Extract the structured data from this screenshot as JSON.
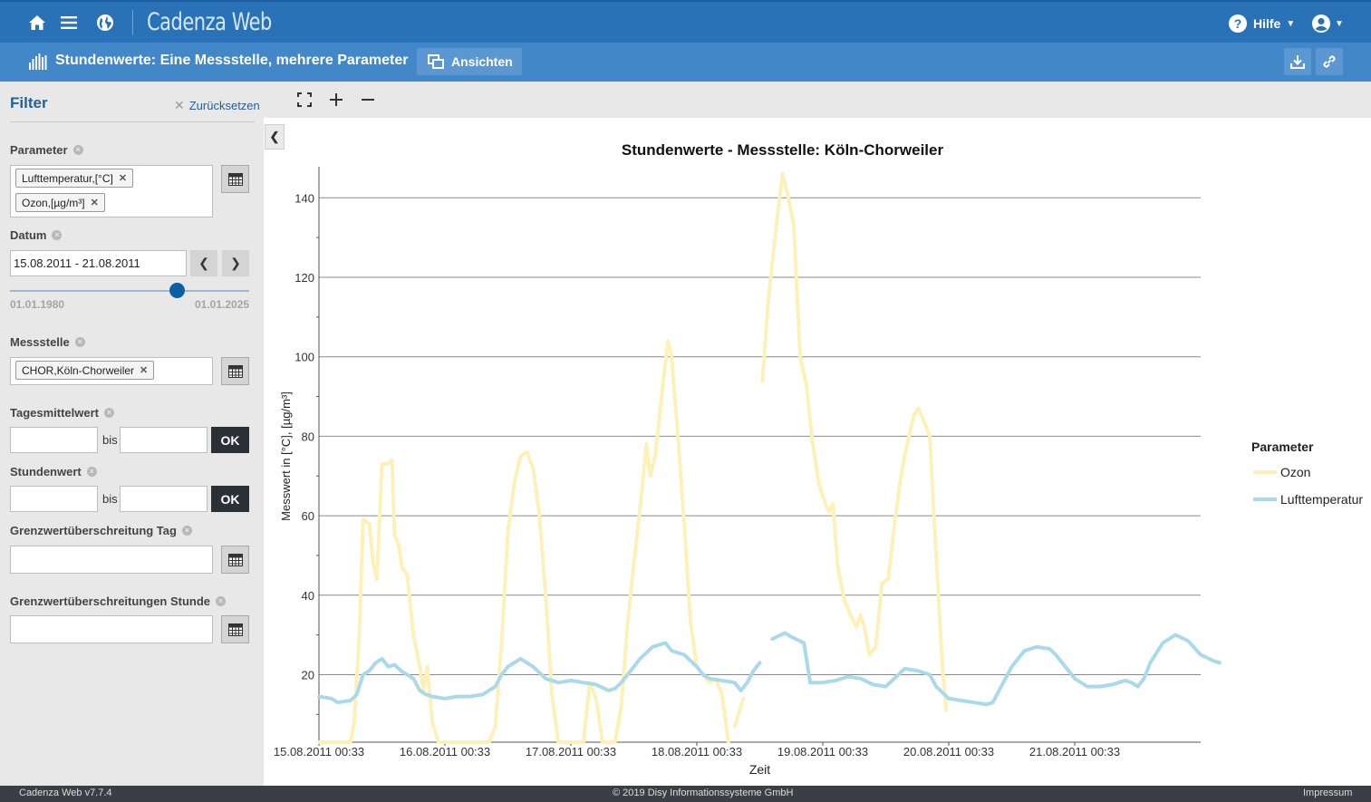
{
  "app": {
    "title": "Cadenza Web",
    "help_label": "Hilfe"
  },
  "toolbar": {
    "page_title": "Stundenwerte: Eine Messstelle, mehrere Parameter",
    "views_label": "Ansichten"
  },
  "filter": {
    "title": "Filter",
    "reset_label": "Zurücksetzen",
    "parameter_label": "Parameter",
    "parameter_tags": [
      "Lufttemperatur,[°C]",
      "Ozon,[µg/m³]"
    ],
    "datum_label": "Datum",
    "datum_value": "15.08.2011 - 21.08.2011",
    "slider_min": "01.01.1980",
    "slider_max": "01.01.2025",
    "slider_position": 0.7,
    "messstelle_label": "Messstelle",
    "messstelle_tags": [
      "CHOR,Köln-Chorweiler"
    ],
    "tagesmittel_label": "Tagesmittelwert",
    "stundenwert_label": "Stundenwert",
    "bis_label": "bis",
    "ok_label": "OK",
    "grenz_tag_label": "Grenzwertüberschreitung Tag",
    "grenz_stunde_label": "Grenzwertüberschreitungen Stunde"
  },
  "chart_data": {
    "type": "line",
    "title": "Stundenwerte - Messstelle: Köln-Chorweiler",
    "xlabel": "Zeit",
    "ylabel": "Messwert in [°C], [µg/m³]",
    "x_tick_labels": [
      "15.08.2011 00:33",
      "16.08.2011 00:33",
      "17.08.2011 00:33",
      "18.08.2011 00:33",
      "19.08.2011 00:33",
      "20.08.2011 00:33",
      "21.08.2011 00:33"
    ],
    "ylim": [
      3,
      146
    ],
    "y_ticks": [
      20,
      40,
      60,
      80,
      100,
      120,
      140
    ],
    "x_unit": "days since 15.08.2011 00:33",
    "legend_title": "Parameter",
    "legend_position": "right",
    "series": [
      {
        "name": "Ozon",
        "color": "#fdf1b8",
        "segments": [
          [
            [
              0,
              3
            ],
            [
              0.25,
              3
            ],
            [
              0.28,
              8
            ],
            [
              0.32,
              30
            ],
            [
              0.35,
              59
            ],
            [
              0.4,
              58
            ],
            [
              0.43,
              48
            ],
            [
              0.46,
              44
            ],
            [
              0.5,
              73
            ],
            [
              0.54,
              73
            ],
            [
              0.58,
              74
            ],
            [
              0.6,
              55
            ],
            [
              0.63,
              53
            ],
            [
              0.66,
              47
            ],
            [
              0.7,
              45
            ],
            [
              0.75,
              30
            ],
            [
              0.8,
              22
            ],
            [
              0.83,
              16
            ],
            [
              0.86,
              22
            ],
            [
              0.9,
              8
            ],
            [
              0.95,
              3
            ],
            [
              1.35,
              3
            ],
            [
              1.4,
              7
            ],
            [
              1.45,
              28
            ],
            [
              1.5,
              56
            ],
            [
              1.55,
              68
            ],
            [
              1.6,
              75
            ],
            [
              1.65,
              76
            ],
            [
              1.7,
              72
            ],
            [
              1.75,
              60
            ],
            [
              1.8,
              40
            ],
            [
              1.85,
              15
            ],
            [
              1.9,
              3
            ],
            [
              2.1,
              3
            ],
            [
              2.15,
              18
            ],
            [
              2.2,
              14
            ],
            [
              2.25,
              3
            ],
            [
              2.35,
              3
            ],
            [
              2.4,
              12
            ],
            [
              2.45,
              33
            ],
            [
              2.5,
              48
            ],
            [
              2.55,
              62
            ],
            [
              2.6,
              78
            ],
            [
              2.63,
              70
            ],
            [
              2.67,
              75
            ],
            [
              2.72,
              90
            ],
            [
              2.77,
              104
            ],
            [
              2.8,
              100
            ],
            [
              2.85,
              80
            ],
            [
              2.9,
              58
            ],
            [
              2.95,
              33
            ],
            [
              3.0,
              22
            ],
            [
              3.05,
              20
            ],
            [
              3.1,
              18
            ],
            [
              3.15,
              19
            ],
            [
              3.2,
              15
            ],
            [
              3.25,
              3
            ]
          ],
          [
            [
              3.3,
              7
            ],
            [
              3.37,
              14
            ]
          ],
          [
            [
              3.52,
              94
            ],
            [
              3.57,
              115
            ],
            [
              3.62,
              130
            ],
            [
              3.68,
              146
            ],
            [
              3.72,
              141
            ],
            [
              3.77,
              133
            ],
            [
              3.82,
              100
            ],
            [
              3.87,
              93
            ],
            [
              3.92,
              78
            ],
            [
              3.97,
              68
            ],
            [
              4.02,
              63
            ],
            [
              4.05,
              61
            ],
            [
              4.08,
              63
            ],
            [
              4.12,
              47
            ],
            [
              4.17,
              39
            ],
            [
              4.22,
              35
            ],
            [
              4.27,
              32
            ],
            [
              4.3,
              35
            ],
            [
              4.33,
              32
            ],
            [
              4.37,
              25
            ],
            [
              4.42,
              27
            ],
            [
              4.47,
              43
            ],
            [
              4.52,
              44
            ],
            [
              4.57,
              58
            ],
            [
              4.62,
              70
            ],
            [
              4.67,
              78
            ],
            [
              4.72,
              85
            ],
            [
              4.76,
              87
            ],
            [
              4.8,
              84
            ],
            [
              4.85,
              80
            ],
            [
              4.9,
              50
            ],
            [
              4.95,
              22
            ],
            [
              4.98,
              11
            ]
          ]
        ]
      },
      {
        "name": "Lufttemperatur",
        "color": "#aad9ea",
        "segments": [
          [
            [
              0,
              14.5
            ],
            [
              0.1,
              14
            ],
            [
              0.15,
              13
            ],
            [
              0.25,
              13.5
            ],
            [
              0.3,
              15
            ],
            [
              0.35,
              20
            ],
            [
              0.4,
              21
            ],
            [
              0.45,
              23
            ],
            [
              0.5,
              24
            ],
            [
              0.55,
              22
            ],
            [
              0.6,
              22.5
            ],
            [
              0.65,
              21
            ],
            [
              0.7,
              20
            ],
            [
              0.75,
              19
            ],
            [
              0.8,
              16
            ],
            [
              0.85,
              15
            ],
            [
              0.9,
              14.5
            ],
            [
              1.0,
              14
            ],
            [
              1.1,
              14.5
            ],
            [
              1.2,
              14.5
            ],
            [
              1.3,
              15
            ],
            [
              1.4,
              17
            ],
            [
              1.45,
              20
            ],
            [
              1.5,
              22
            ],
            [
              1.6,
              24
            ],
            [
              1.7,
              22
            ],
            [
              1.8,
              19
            ],
            [
              1.9,
              18
            ],
            [
              2.0,
              18.5
            ],
            [
              2.1,
              18
            ],
            [
              2.2,
              17.5
            ],
            [
              2.3,
              16
            ],
            [
              2.35,
              16.5
            ],
            [
              2.4,
              18
            ],
            [
              2.45,
              20
            ],
            [
              2.55,
              24
            ],
            [
              2.65,
              27
            ],
            [
              2.75,
              28
            ],
            [
              2.8,
              26
            ],
            [
              2.9,
              25
            ],
            [
              3.0,
              22
            ],
            [
              3.05,
              20
            ],
            [
              3.1,
              19
            ],
            [
              3.2,
              18.5
            ],
            [
              3.3,
              18
            ],
            [
              3.35,
              16
            ],
            [
              3.4,
              18
            ],
            [
              3.45,
              21
            ],
            [
              3.5,
              23
            ]
          ],
          [
            [
              3.6,
              29
            ],
            [
              3.7,
              30.5
            ],
            [
              3.75,
              29.5
            ],
            [
              3.85,
              28
            ],
            [
              3.9,
              18
            ],
            [
              4.0,
              18
            ],
            [
              4.1,
              18.5
            ],
            [
              4.2,
              19.5
            ],
            [
              4.3,
              19
            ],
            [
              4.4,
              17.5
            ],
            [
              4.5,
              17
            ],
            [
              4.55,
              18.5
            ],
            [
              4.65,
              21.5
            ],
            [
              4.75,
              21
            ],
            [
              4.85,
              20
            ],
            [
              4.9,
              17
            ],
            [
              5.0,
              14
            ],
            [
              5.1,
              13.5
            ],
            [
              5.2,
              13
            ],
            [
              5.3,
              12.5
            ],
            [
              5.35,
              13
            ],
            [
              5.4,
              16
            ],
            [
              5.5,
              22
            ],
            [
              5.6,
              26
            ],
            [
              5.7,
              27
            ],
            [
              5.8,
              26.5
            ],
            [
              5.85,
              25
            ],
            [
              5.9,
              23
            ],
            [
              6.0,
              19
            ],
            [
              6.1,
              17
            ],
            [
              6.2,
              17
            ],
            [
              6.3,
              17.5
            ],
            [
              6.4,
              18.5
            ],
            [
              6.45,
              18
            ],
            [
              6.5,
              17
            ],
            [
              6.55,
              19
            ],
            [
              6.6,
              23
            ],
            [
              6.7,
              28
            ],
            [
              6.8,
              30
            ],
            [
              6.9,
              28.5
            ],
            [
              7.0,
              25
            ],
            [
              7.1,
              23.5
            ],
            [
              7.15,
              23
            ]
          ]
        ]
      }
    ]
  },
  "footer": {
    "version": "Cadenza Web v7.7.4",
    "copyright": "© 2019 Disy Informationssysteme GmbH",
    "impressum": "Impressum"
  }
}
